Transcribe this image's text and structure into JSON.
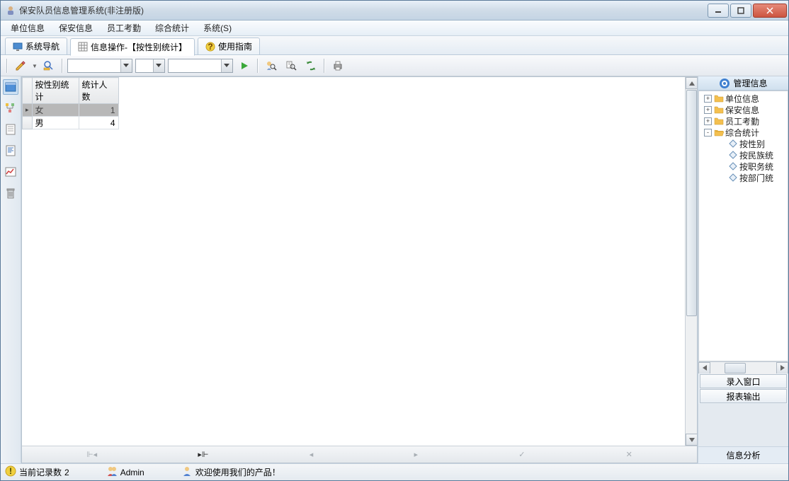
{
  "window": {
    "title": "保安队员信息管理系统(非注册版)"
  },
  "menubar": [
    "单位信息",
    "保安信息",
    "员工考勤",
    "综合统计",
    "系统(S)"
  ],
  "tabs": [
    {
      "label": "系统导航",
      "icon": "monitor-icon"
    },
    {
      "label": "信息操作-【按性别统计】",
      "icon": "grid-icon",
      "active": true
    },
    {
      "label": "使用指南",
      "icon": "help-icon"
    }
  ],
  "toolbar": {
    "combo1": "",
    "combo2": "",
    "combo3": ""
  },
  "grid": {
    "columns": [
      "按性别统计",
      "统计人数"
    ],
    "rows": [
      {
        "c0": "女",
        "c1": "1",
        "selected": true
      },
      {
        "c0": "男",
        "c1": "4",
        "selected": false
      }
    ]
  },
  "rightpanel": {
    "header": "管理信息",
    "tree": [
      {
        "label": "单位信息",
        "exp": "+",
        "depth": 1,
        "icon": "folder"
      },
      {
        "label": "保安信息",
        "exp": "+",
        "depth": 1,
        "icon": "folder"
      },
      {
        "label": "员工考勤",
        "exp": "+",
        "depth": 1,
        "icon": "folder"
      },
      {
        "label": "综合统计",
        "exp": "-",
        "depth": 1,
        "icon": "folder-open"
      },
      {
        "label": "按性别",
        "exp": "",
        "depth": 2,
        "icon": "diamond"
      },
      {
        "label": "按民族统",
        "exp": "",
        "depth": 2,
        "icon": "diamond"
      },
      {
        "label": "按职务统",
        "exp": "",
        "depth": 2,
        "icon": "diamond"
      },
      {
        "label": "按部门统",
        "exp": "",
        "depth": 2,
        "icon": "diamond"
      }
    ],
    "buttons": [
      "录入窗口",
      "报表输出"
    ],
    "footer": "信息分析"
  },
  "statusbar": {
    "records_label": "当前记录数",
    "records_count": "2",
    "user": "Admin",
    "welcome": "欢迎使用我们的产品！"
  }
}
